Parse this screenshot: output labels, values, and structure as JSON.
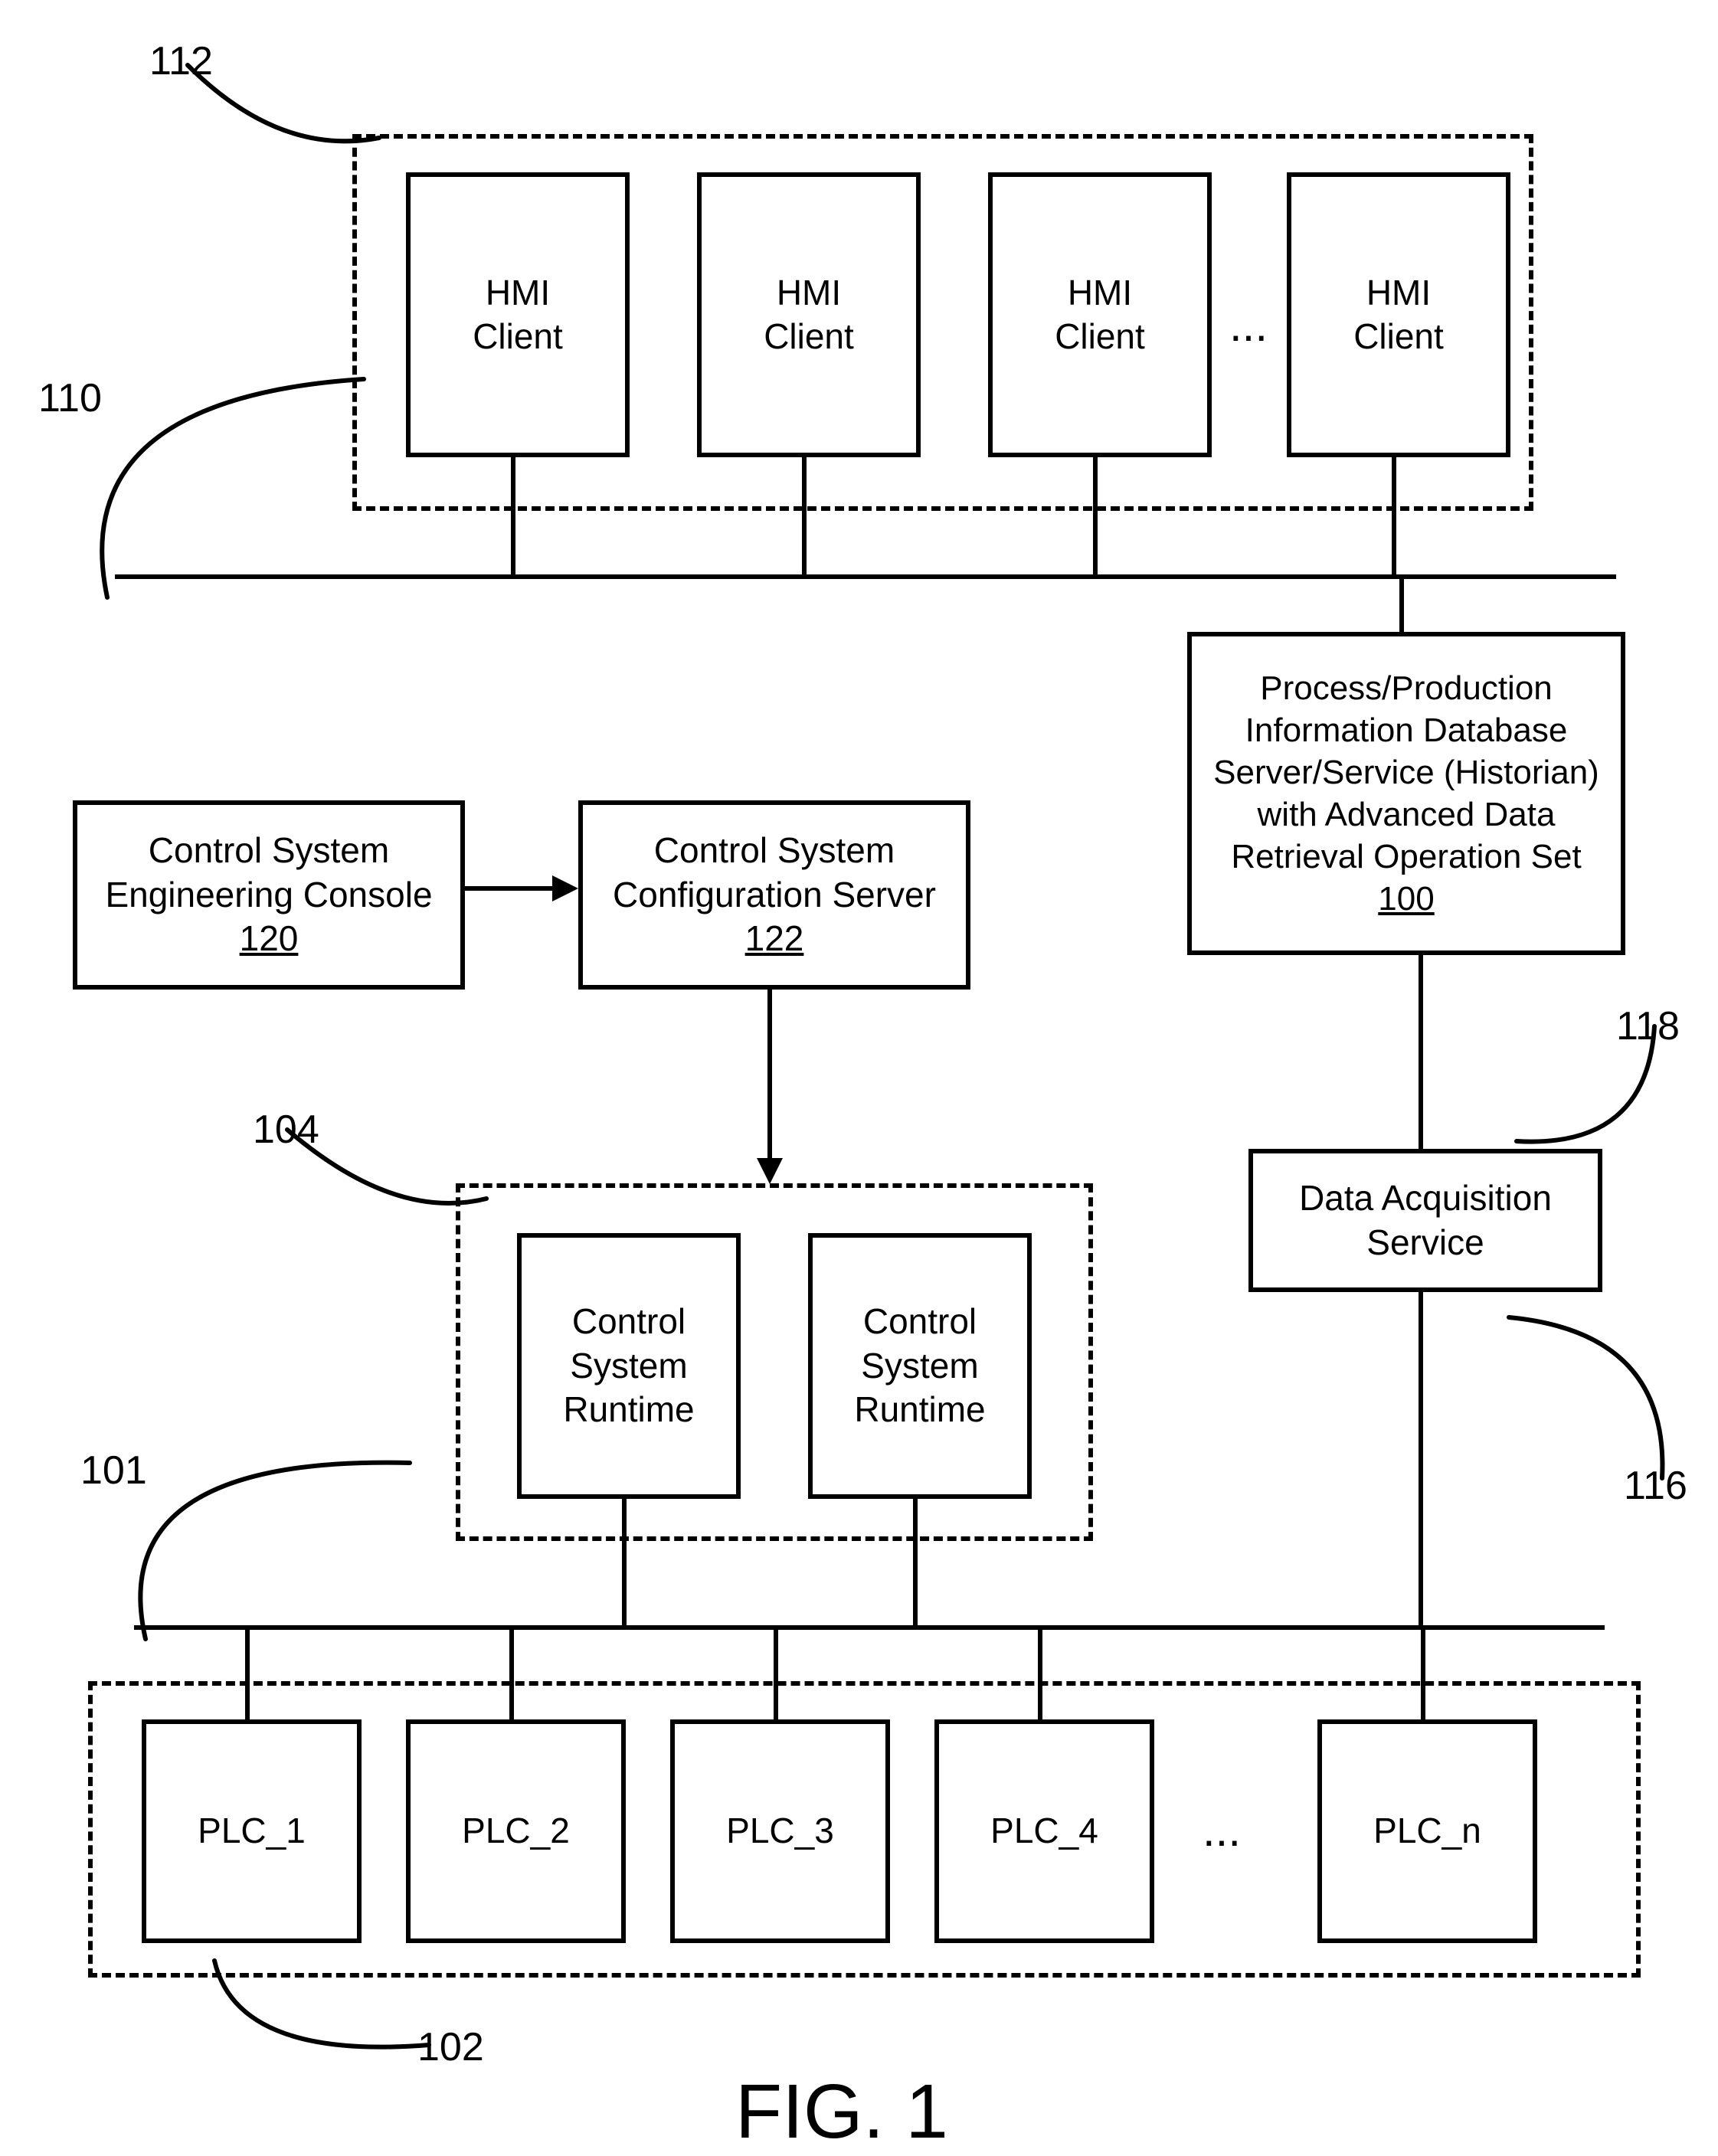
{
  "blocks": {
    "hmiA": "HMI\nClient",
    "hmiB": "HMI\nClient",
    "hmiC": "HMI\nClient",
    "hmiD": "HMI\nClient",
    "hmiEllipsis": "...",
    "engConsoleLine1": "Control System",
    "engConsoleLine2": "Engineering Console",
    "engConsoleRef": "120",
    "cfgServerLine1": "Control System",
    "cfgServerLine2": "Configuration Server",
    "cfgServerRef": "122",
    "historianLine1": "Process/Production",
    "historianLine2": "Information Database",
    "historianLine3": "Server/Service (Historian)",
    "historianLine4": "with Advanced Data",
    "historianLine5": "Retrieval Operation Set",
    "historianRef": "100",
    "runtimeA": "Control\nSystem\nRuntime",
    "runtimeB": "Control\nSystem\nRuntime",
    "das": "Data Acquisition\nService",
    "plc1": "PLC_1",
    "plc2": "PLC_2",
    "plc3": "PLC_3",
    "plc4": "PLC_4",
    "plcDots": "...",
    "plcN": "PLC_n"
  },
  "labels": {
    "l112": "112",
    "l110": "110",
    "l104": "104",
    "l101": "101",
    "l102": "102",
    "l118": "118",
    "l116": "116"
  },
  "figure": "FIG. 1"
}
